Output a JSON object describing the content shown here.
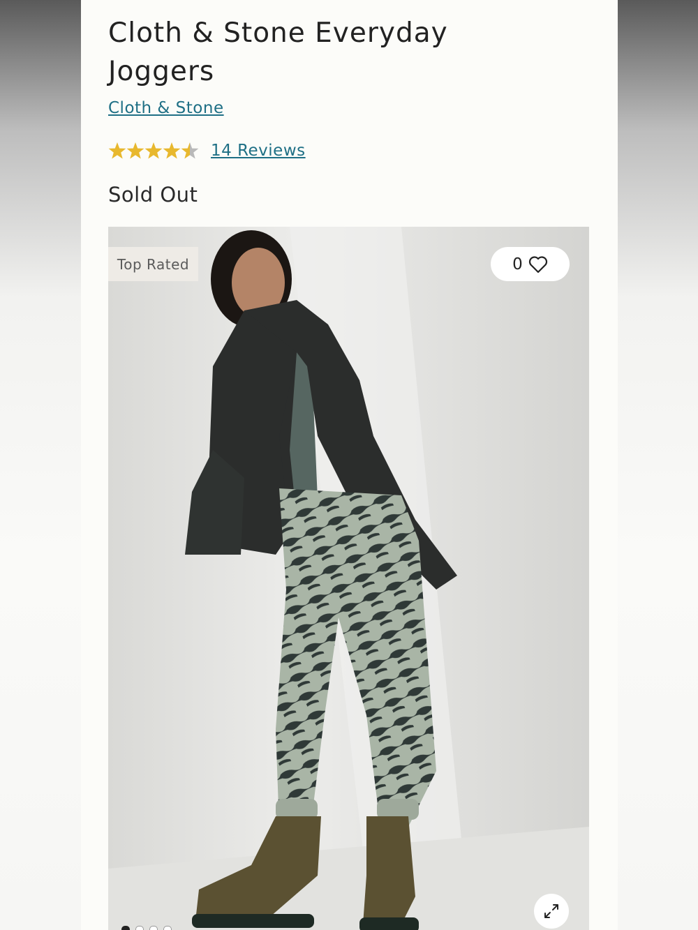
{
  "product": {
    "title": "Cloth & Stone Everyday Joggers",
    "brand": "Cloth & Stone",
    "rating": 4.5,
    "rating_max": 5,
    "reviews_label": "14 Reviews",
    "status": "Sold Out"
  },
  "gallery": {
    "badge": "Top Rated",
    "favorite_count": "0",
    "icons": {
      "favorite": "heart-icon",
      "zoom": "expand-icon"
    },
    "slide_count": 4,
    "active_slide": 0
  },
  "colors": {
    "link": "#1e6f85",
    "star": "#e8b82e",
    "star_empty": "#b9b9b9",
    "text": "#222222"
  }
}
